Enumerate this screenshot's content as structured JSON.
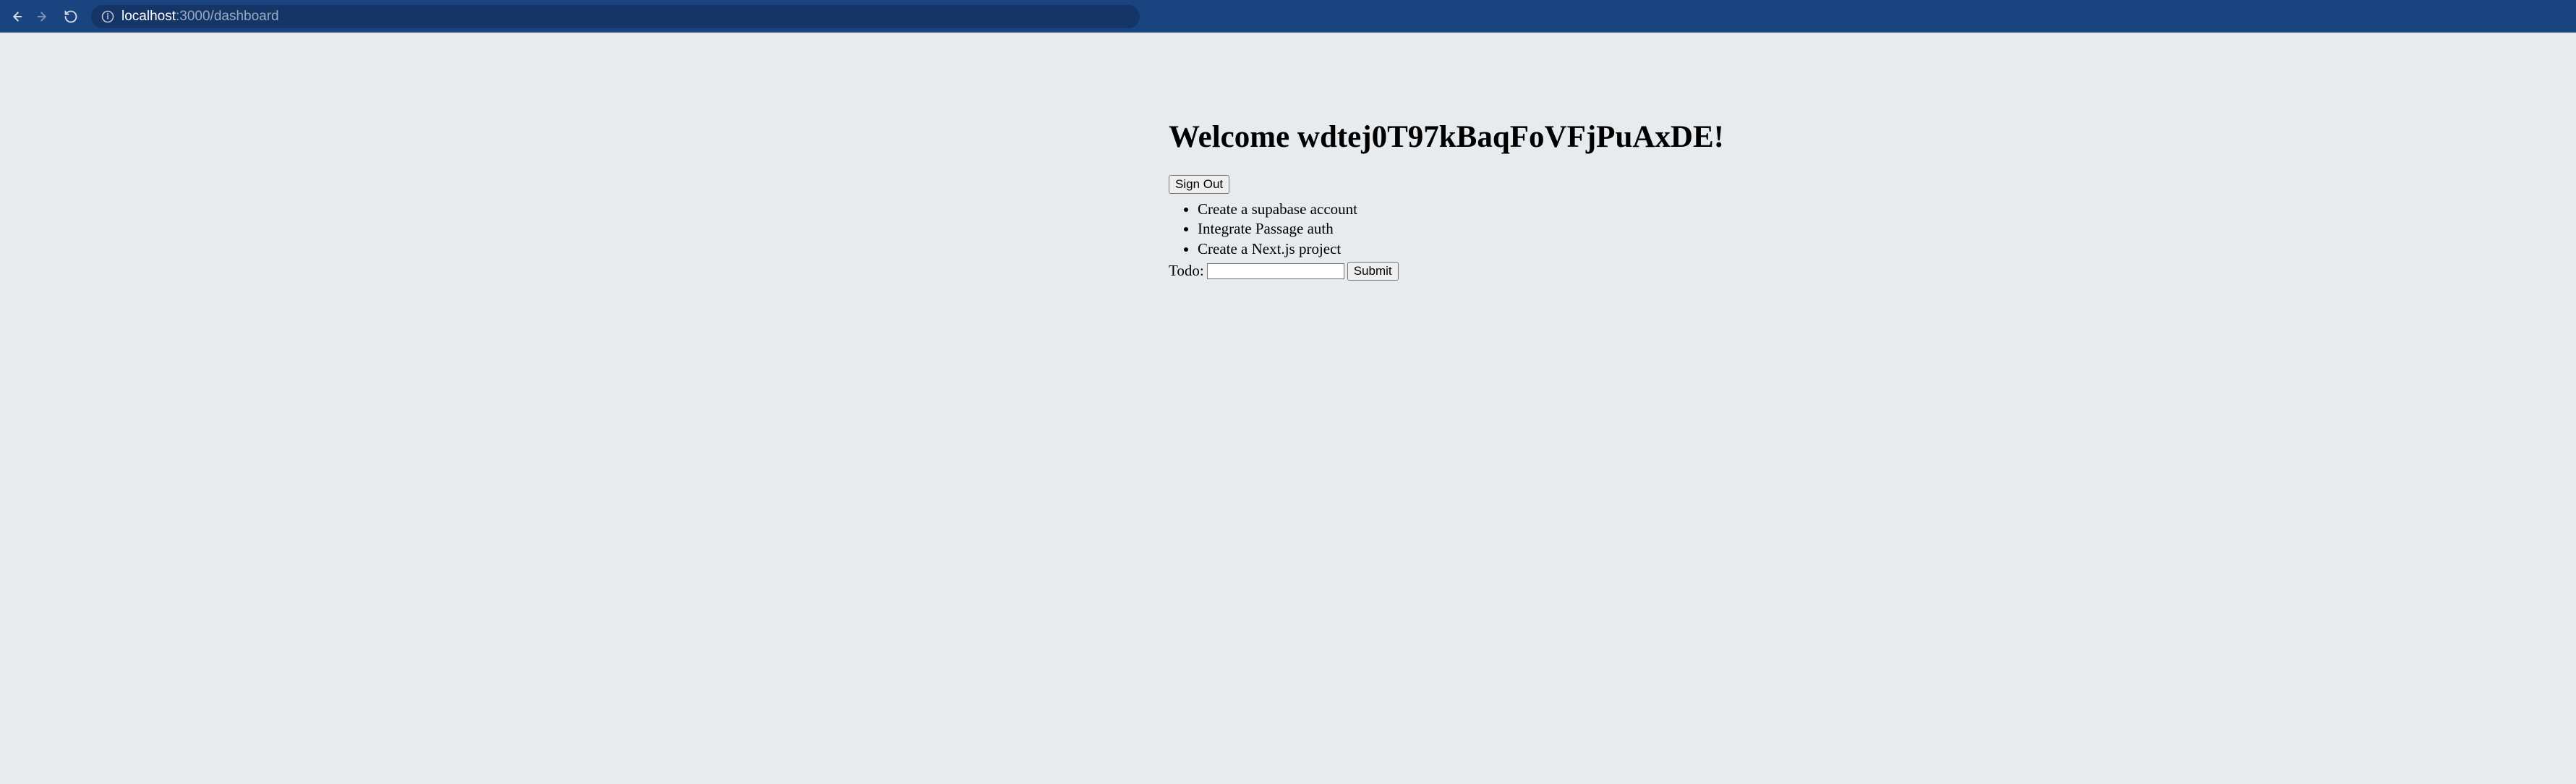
{
  "browser": {
    "url_host": "localhost",
    "url_port_path": ":3000/dashboard"
  },
  "page": {
    "heading": "Welcome wdtej0T97kBaqFoVFjPuAxDE!",
    "signout_label": "Sign Out",
    "todos": [
      "Create a supabase account",
      "Integrate Passage auth",
      "Create a Next.js project"
    ],
    "form": {
      "label": "Todo: ",
      "input_value": "",
      "submit_label": "Submit"
    }
  }
}
